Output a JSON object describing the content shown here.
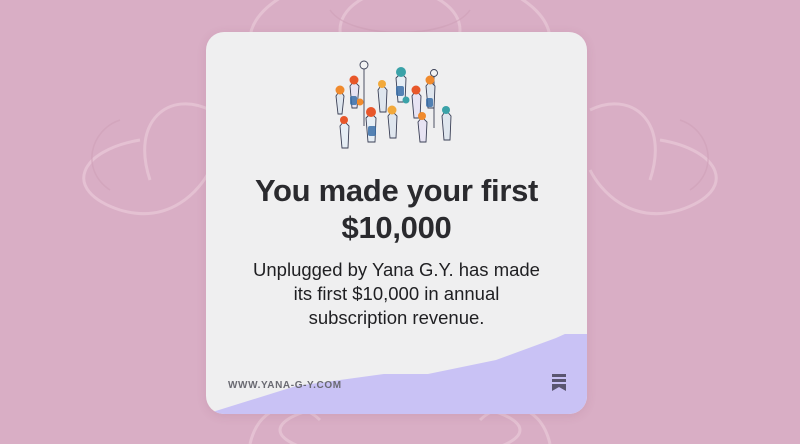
{
  "card": {
    "headline": "You made your first $10,000",
    "body": "Unplugged by Yana G.Y. has made its first $10,000 in annual subscription revenue.",
    "site_url": "WWW.YANA-G-Y.COM"
  },
  "icons": {
    "illustration": "crowd-illustration",
    "bookmark": "bookmark-icon"
  },
  "colors": {
    "background": "#d9aec5",
    "card": "#efeff0",
    "accent_wave": "#c9c2f5",
    "headline": "#2a2a2e"
  }
}
